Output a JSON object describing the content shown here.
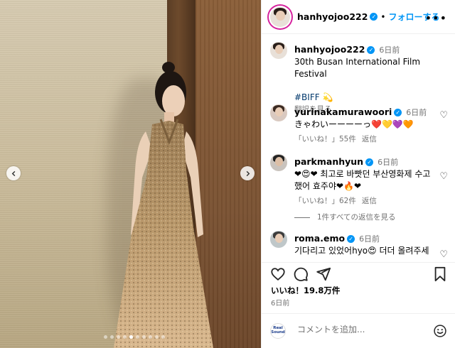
{
  "post": {
    "username": "hanhyojoo222",
    "follow_label": "フォローする",
    "separator": "•"
  },
  "caption": {
    "username": "hanhyojoo222",
    "time": "6日前",
    "text": "30th Busan International Film Festival",
    "hashtag": "#BIFF",
    "hashtag_emoji": "💫",
    "translate_label": "翻訳を見る"
  },
  "comments": [
    {
      "username": "yurinakamurawoori",
      "time": "6日前",
      "text": "きゃわいーーーーっ❤️💛💜🧡",
      "likes": "「いいね！」55件",
      "reply_label": "返信"
    },
    {
      "username": "parkmanhyun",
      "time": "6日前",
      "text": "❤😍❤ 최고로 바빳던 부산영화제 수고했어 효주야❤🔥❤",
      "likes": "「いいね！」62件",
      "reply_label": "返信",
      "replies_link": "1件すべての返信を見る"
    },
    {
      "username": "roma.emo",
      "time": "6日前",
      "text": "기다리고 있었어hyo😍 더더 올려주세"
    }
  ],
  "actions": {
    "likes_text": "いいね！19.8万件",
    "posted_time": "6日前"
  },
  "comment_box": {
    "placeholder": "コメントを追加...",
    "avatar_text": "Real Sound"
  },
  "carousel": {
    "total_slides": 10,
    "active_index": 4
  },
  "icons": {
    "more": "more-icon",
    "like": "heart-icon",
    "comment": "comment-icon",
    "share": "paper-plane-icon",
    "save": "bookmark-icon",
    "emoji": "smiley-icon",
    "verified": "verified-badge-icon"
  },
  "colors": {
    "accent": "#0095f6",
    "hashtag": "#00376b",
    "muted": "#737373",
    "border": "#efefef"
  }
}
